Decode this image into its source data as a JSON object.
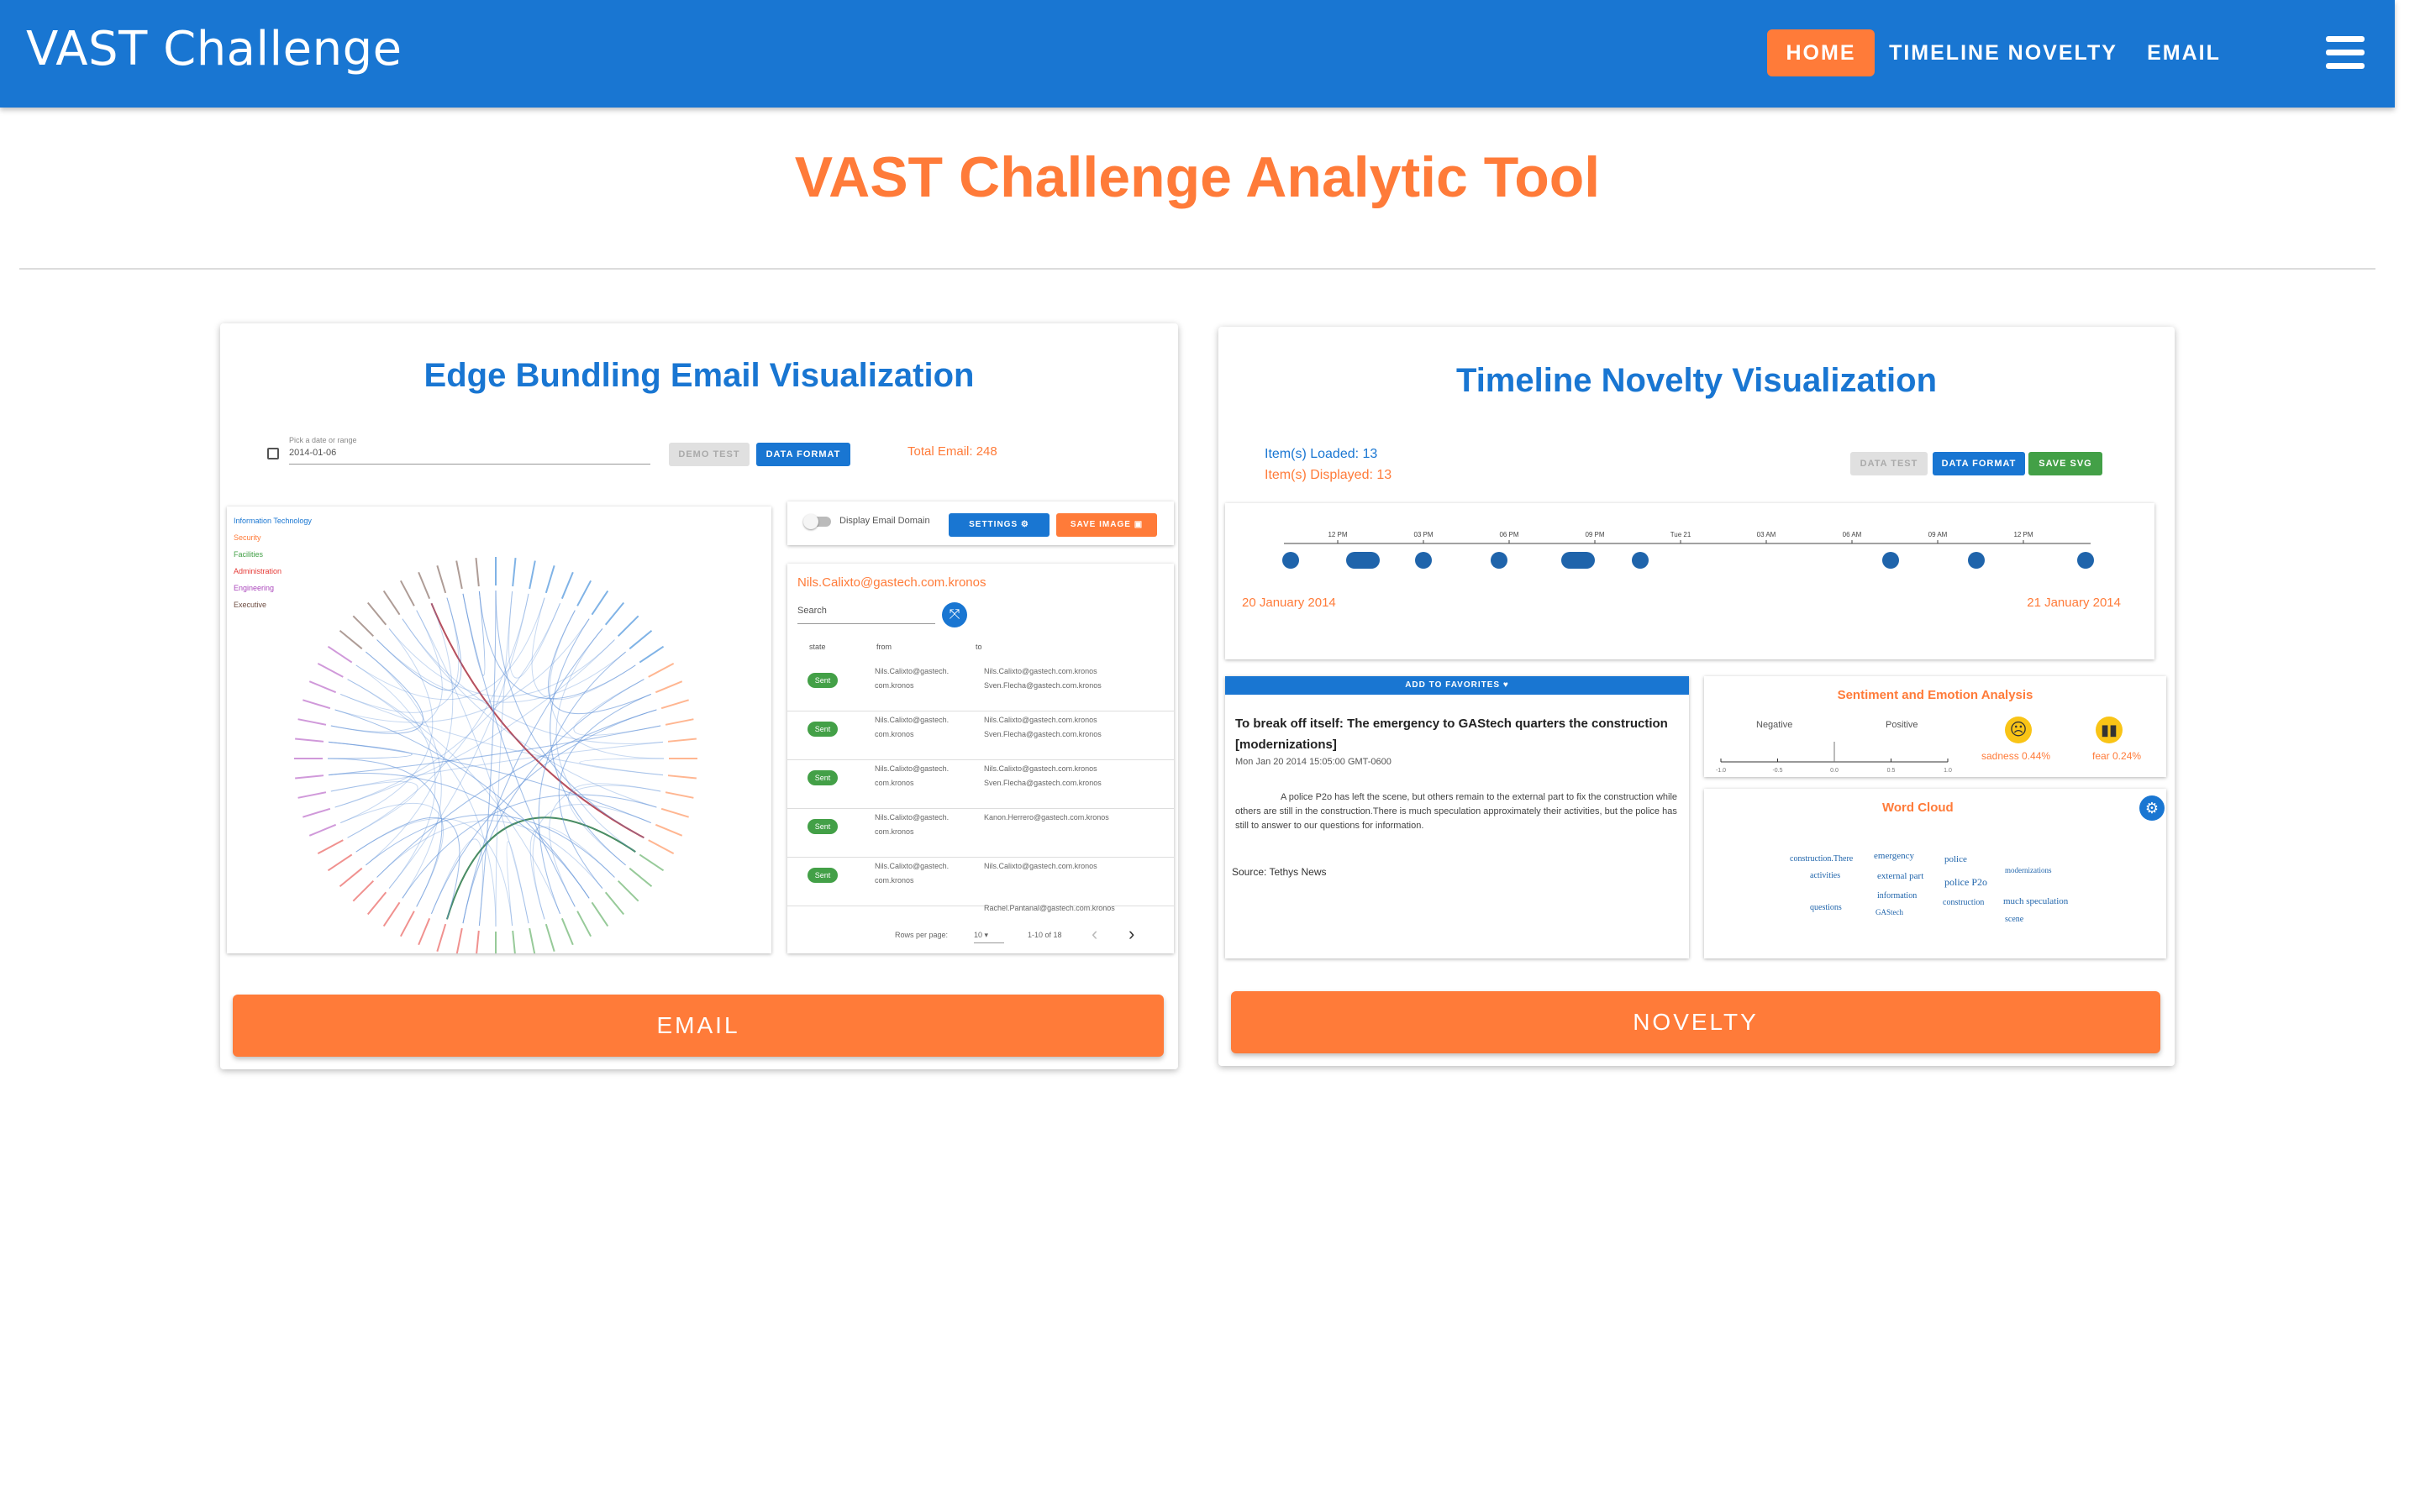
{
  "appbar": {
    "brand": "VAST Challenge",
    "nav": {
      "home": "HOME",
      "timeline": "TIMELINE NOVELTY",
      "email": "EMAIL"
    }
  },
  "page_title": "VAST Challenge Analytic Tool",
  "email_card": {
    "title": "Edge Bundling Email Visualization",
    "button": "EMAIL",
    "preview": {
      "date_label": "Pick a date or range",
      "date_value": "2014-01-06",
      "demo_test": "DEMO TEST",
      "data_format": "DATA FORMAT",
      "total_email": "Total Email: 248",
      "legend": [
        {
          "label": "Information Technology",
          "color": "#1976d2"
        },
        {
          "label": "Security",
          "color": "#ff7b39"
        },
        {
          "label": "Facilities",
          "color": "#43a047"
        },
        {
          "label": "Administration",
          "color": "#e53935"
        },
        {
          "label": "Engineering",
          "color": "#ab47bc"
        },
        {
          "label": "Executive",
          "color": "#6d4c41"
        }
      ],
      "display_domain": "Display Email Domain",
      "settings": "SETTINGS",
      "save_image": "SAVE IMAGE",
      "selected_email": "Nils.Calixto@gastech.com.kronos",
      "search": "Search",
      "columns": [
        "state",
        "from",
        "to"
      ],
      "rows": [
        {
          "state": "Sent",
          "from": [
            "Nils.Calixto@gastech.",
            "com.kronos"
          ],
          "to": [
            "Nils.Calixto@gastech.com.kronos",
            "Sven.Flecha@gastech.com.kronos"
          ]
        },
        {
          "state": "Sent",
          "from": [
            "Nils.Calixto@gastech.",
            "com.kronos"
          ],
          "to": [
            "Nils.Calixto@gastech.com.kronos",
            "Sven.Flecha@gastech.com.kronos"
          ]
        },
        {
          "state": "Sent",
          "from": [
            "Nils.Calixto@gastech.",
            "com.kronos"
          ],
          "to": [
            "Nils.Calixto@gastech.com.kronos",
            "Sven.Flecha@gastech.com.kronos"
          ]
        },
        {
          "state": "Sent",
          "from": [
            "Nils.Calixto@gastech.",
            "com.kronos"
          ],
          "to": [
            "Kanon.Herrero@gastech.com.kronos",
            ""
          ]
        },
        {
          "state": "Sent",
          "from": [
            "Nils.Calixto@gastech.",
            "com.kronos"
          ],
          "to": [
            "Nils.Calixto@gastech.com.kronos",
            ""
          ]
        }
      ],
      "last_row_to": "Rachel.Pantanal@gastech.com.kronos",
      "rows_per_page_label": "Rows per page:",
      "rows_per_page": "10",
      "pagination": "1-10 of 18"
    }
  },
  "novelty_card": {
    "title": "Timeline Novelty Visualization",
    "button": "NOVELTY",
    "preview": {
      "items_loaded": "Item(s) Loaded: 13",
      "items_displayed": "Item(s) Displayed: 13",
      "data_test": "DATA TEST",
      "data_format": "DATA FORMAT",
      "save_svg": "SAVE SVG",
      "ticks": [
        "12 PM",
        "03 PM",
        "06 PM",
        "09 PM",
        "Tue 21",
        "03 AM",
        "06 AM",
        "09 AM",
        "12 PM"
      ],
      "date_start": "20 January 2014",
      "date_end": "21 January 2014",
      "add_favorites": "ADD TO FAVORITES",
      "article_title": "To break off itself: The emergency to GAStech quarters the construction [modernizations]",
      "article_date": "Mon Jan 20 2014 15:05:00 GMT-0600",
      "article_body": "A police P2o has left the scene, but others remain to the external part to fix the construction while others are still in the construction.There is much speculation approximately their activities, but the police has still to answer to our questions for information.",
      "article_source": "Source: Tethys News",
      "sentiment_title": "Sentiment and Emotion Analysis",
      "negative": "Negative",
      "positive": "Positive",
      "sentiment_ticks": [
        "-1.0",
        "-0.5",
        "0.0",
        "0.5",
        "1.0"
      ],
      "sadness": "sadness 0.44%",
      "fear": "fear 0.24%",
      "word_cloud_title": "Word Cloud",
      "words": [
        "construction.There",
        "emergency",
        "police",
        "modernizations",
        "activities",
        "external part",
        "police P2o",
        "information",
        "construction",
        "much speculation",
        "questions",
        "GAStech",
        "scene"
      ]
    }
  }
}
